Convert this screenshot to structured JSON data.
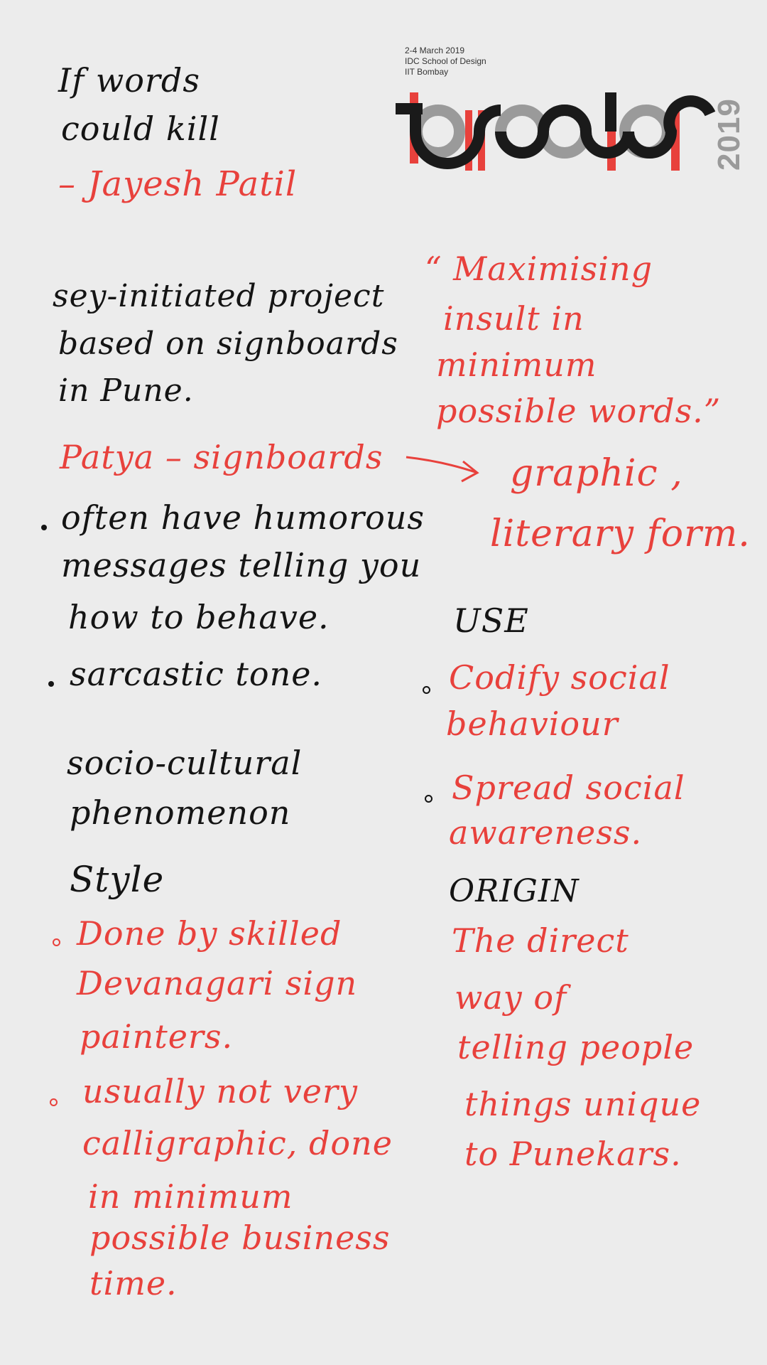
{
  "colors": {
    "ink": "#141414",
    "accent": "#e8413c",
    "logo_dark": "#1a1a1a",
    "logo_grey": "#9a9a9a"
  },
  "event": {
    "dates": "2-4 March 2019",
    "school": "IDC School of Design",
    "institute": "IIT Bombay",
    "year": "2019"
  },
  "title": {
    "line1": "If words",
    "line2": "could kill",
    "author": "– Jayesh Patil"
  },
  "intro": {
    "line1": "sey-initiated project",
    "line2": "based on signboards",
    "line3": "in Pune."
  },
  "quote": {
    "line1": "“ Maximising",
    "line2": "insult in",
    "line3": "minimum",
    "line4": "possible words.”"
  },
  "patya": {
    "label": "Patya – signboards",
    "form_line1": "graphic ,",
    "form_line2": "literary form."
  },
  "features": {
    "b1_line1": "often have humorous",
    "b1_line2": "messages telling you",
    "b1_line3": "how to behave.",
    "b2": "sarcastic tone."
  },
  "socio": {
    "line1": "socio-cultural",
    "line2": "phenomenon"
  },
  "use": {
    "heading": "USE",
    "b1_line1": "Codify social",
    "b1_line2": "behaviour",
    "b2_line1": "Spread social",
    "b2_line2": "awareness."
  },
  "style": {
    "heading": "Style",
    "b1_line1": "Done by skilled",
    "b1_line2": "Devanagari sign",
    "b1_line3": "painters.",
    "b2_line1": "usually not very",
    "b2_line2": "calligraphic, done",
    "b2_line3": "in minimum",
    "b2_line4": "possible business",
    "b2_line5": "time."
  },
  "origin": {
    "heading": "ORIGIN",
    "line1": "The direct",
    "line2": "way of",
    "line3": "telling people",
    "line4": "things unique",
    "line5": "to Punekars."
  }
}
